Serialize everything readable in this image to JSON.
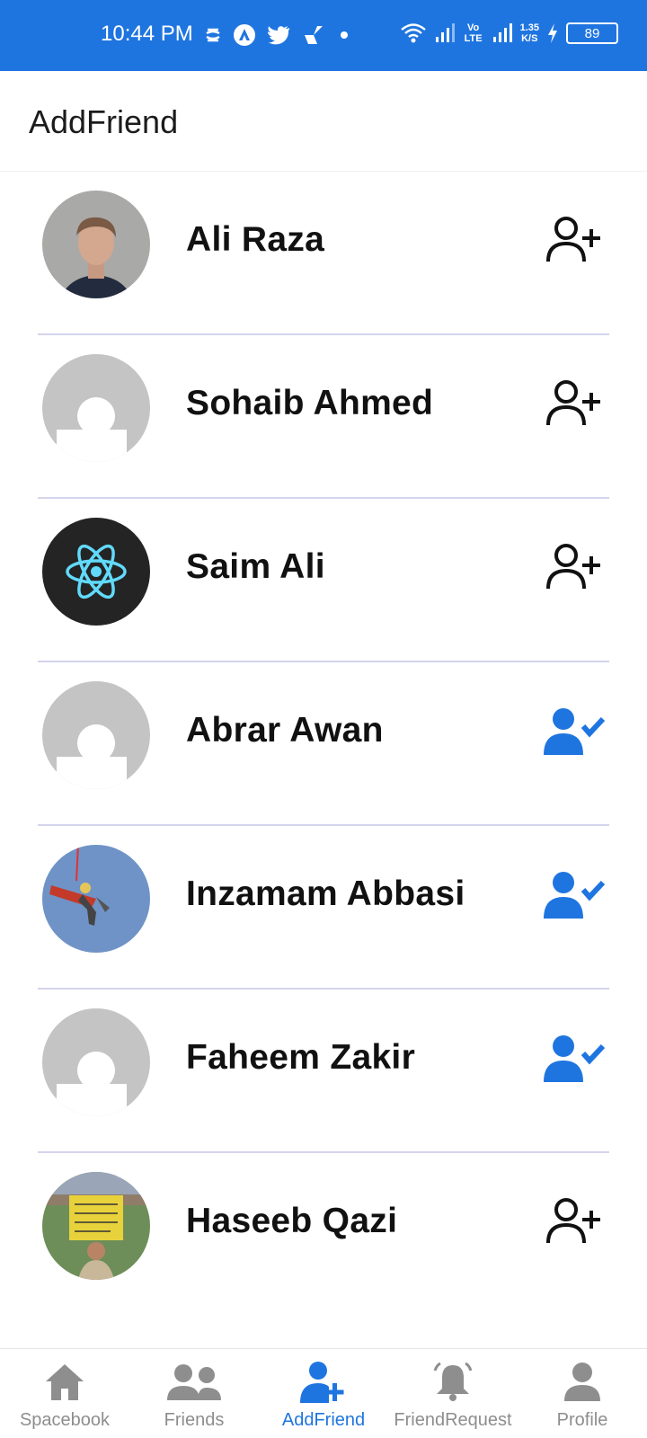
{
  "status_bar": {
    "time": "10:44 PM",
    "battery": "89",
    "net_speed_value": "1.35",
    "net_speed_unit": "K/S",
    "volte": "Vo LTE",
    "background_color": "#1f75e0"
  },
  "header": {
    "title": "AddFriend"
  },
  "friends": [
    {
      "name": "Ali Raza",
      "avatar": "photo-man",
      "status": "add"
    },
    {
      "name": "Sohaib Ahmed",
      "avatar": "placeholder",
      "status": "add"
    },
    {
      "name": "Saim Ali",
      "avatar": "react-logo",
      "status": "add"
    },
    {
      "name": "Abrar Awan",
      "avatar": "placeholder",
      "status": "requested"
    },
    {
      "name": "Inzamam Abbasi",
      "avatar": "photo-sky",
      "status": "requested"
    },
    {
      "name": "Faheem Zakir",
      "avatar": "placeholder",
      "status": "requested"
    },
    {
      "name": "Haseeb Qazi",
      "avatar": "photo-stadium",
      "status": "add"
    }
  ],
  "bottom_nav": {
    "items": [
      {
        "label": "Spacebook",
        "icon": "home-icon"
      },
      {
        "label": "Friends",
        "icon": "friends-icon"
      },
      {
        "label": "AddFriend",
        "icon": "add-friend-icon",
        "active": true
      },
      {
        "label": "FriendRequest",
        "icon": "bell-icon"
      },
      {
        "label": "Profile",
        "icon": "profile-icon"
      }
    ]
  },
  "colors": {
    "accent": "#1f75e0",
    "inactive": "#8e8e8e",
    "divider": "#d4d4ec"
  }
}
